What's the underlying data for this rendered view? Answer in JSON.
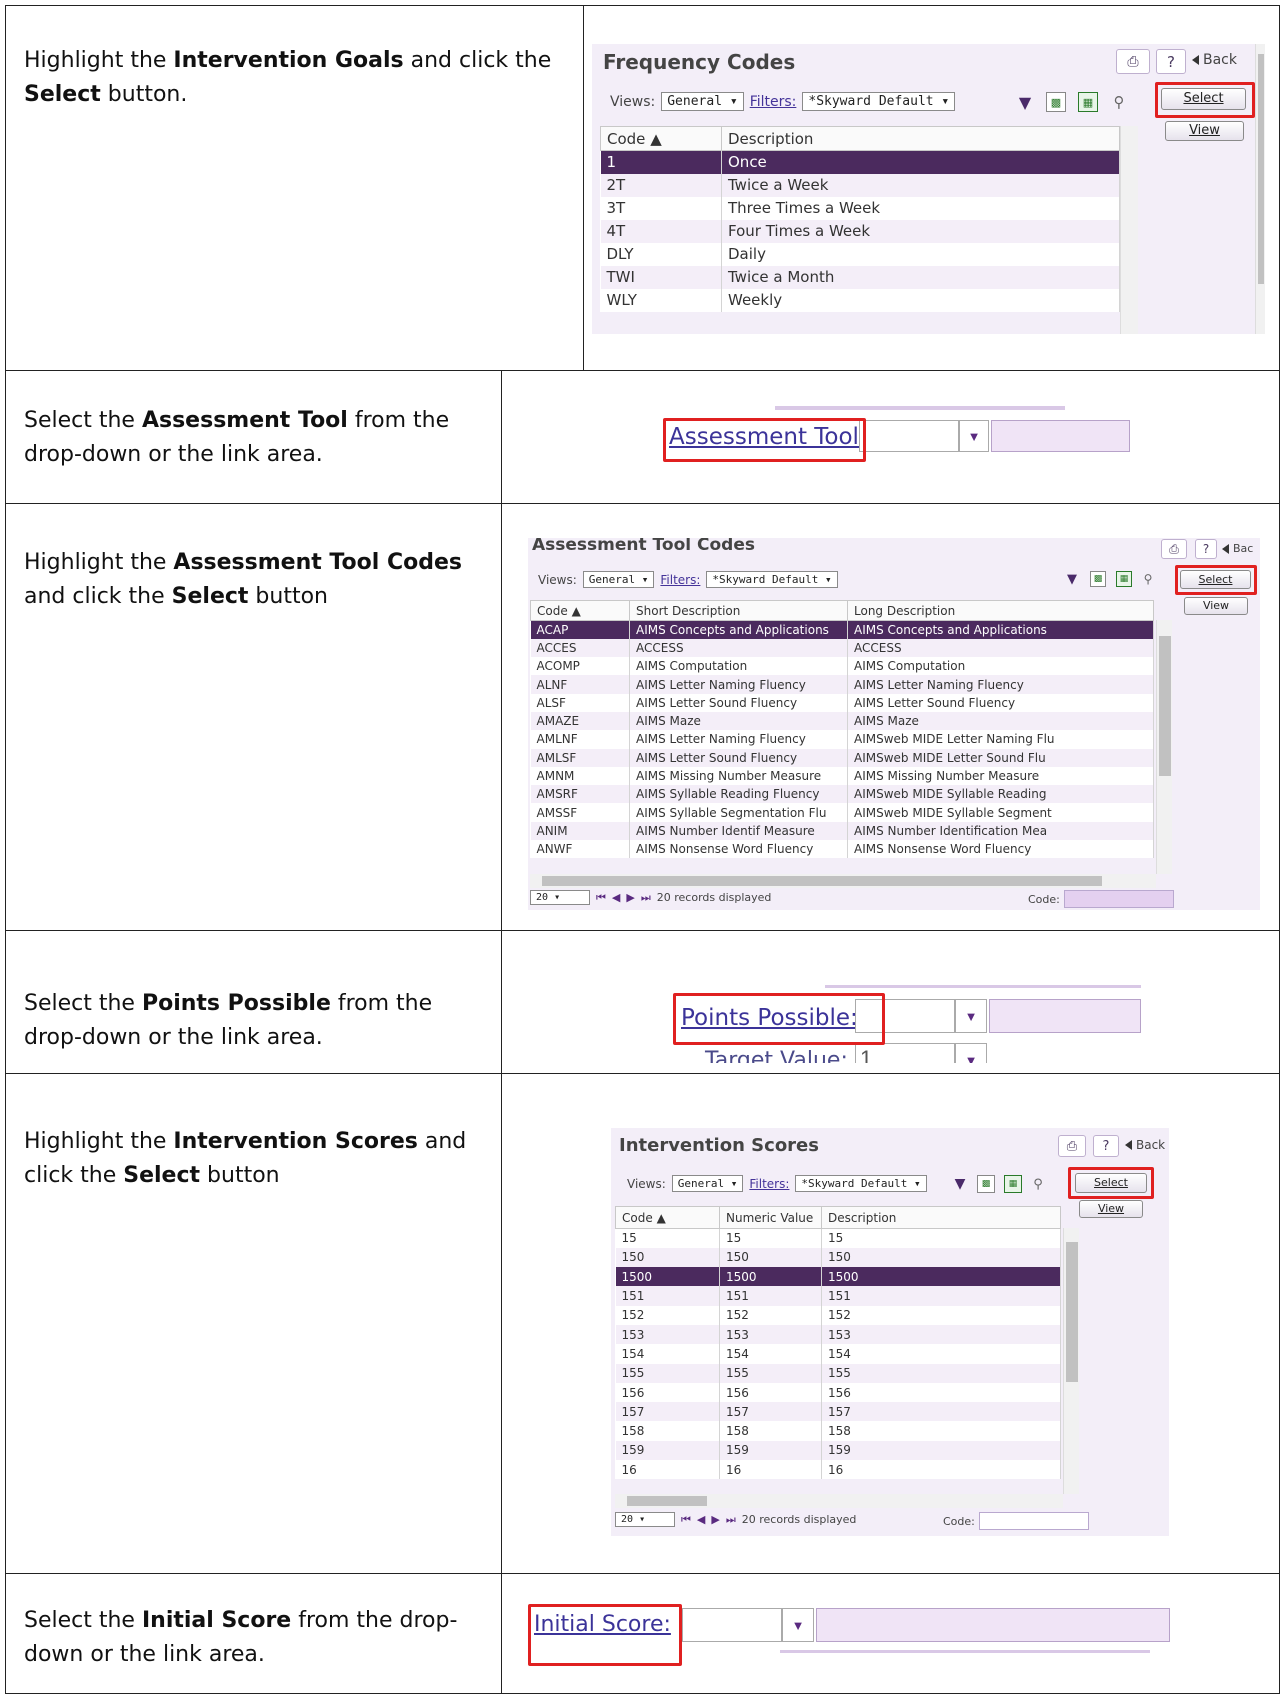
{
  "steps": [
    {
      "pre": "Highlight the ",
      "bold1": "Intervention Goals",
      "mid": " and click the ",
      "bold2": "Select",
      "post": " button."
    },
    {
      "pre": "Select the ",
      "bold1": "Assessment Tool",
      "post": " from the drop-down or the link area."
    },
    {
      "pre": "Highlight the ",
      "bold1": "Assessment Tool Codes",
      "mid": " and click the ",
      "bold2": "Select",
      "post": " button"
    },
    {
      "pre": "Select the ",
      "bold1": "Points Possible",
      "post": " from the drop-down or the link area."
    },
    {
      "pre": "Highlight the ",
      "bold1": "Intervention Scores",
      "mid": " and click the ",
      "bold2": "Select",
      "post": " button"
    },
    {
      "pre": "Select the ",
      "bold1": "Initial Score",
      "post": " from the drop-down or the link area."
    }
  ],
  "common": {
    "views_label": "Views:",
    "views_value": "General",
    "filters_label": "Filters:",
    "filters_value": "*Skyward Default",
    "help": "?",
    "back": "Back",
    "select_btn": "Select",
    "view_btn": "View"
  },
  "freq": {
    "title": "Frequency Codes",
    "columns": [
      "Code",
      "Description"
    ],
    "rows": [
      [
        "1",
        "Once"
      ],
      [
        "2T",
        "Twice a Week"
      ],
      [
        "3T",
        "Three Times a Week"
      ],
      [
        "4T",
        "Four Times a Week"
      ],
      [
        "DLY",
        "Daily"
      ],
      [
        "TWI",
        "Twice a Month"
      ],
      [
        "WLY",
        "Weekly"
      ]
    ]
  },
  "tool_field": {
    "label": "Assessment Tool:"
  },
  "atc": {
    "title": "Assessment Tool Codes",
    "back": "Bac",
    "columns": [
      "Code",
      "Short Description",
      "Long Description"
    ],
    "rows": [
      [
        "ACAP",
        "AIMS Concepts and Applications",
        "AIMS Concepts and Applications"
      ],
      [
        "ACCES",
        "ACCESS",
        "ACCESS"
      ],
      [
        "ACOMP",
        "AIMS Computation",
        "AIMS Computation"
      ],
      [
        "ALNF",
        "AIMS Letter Naming Fluency",
        "AIMS Letter Naming Fluency"
      ],
      [
        "ALSF",
        "AIMS Letter Sound Fluency",
        "AIMS Letter Sound Fluency"
      ],
      [
        "AMAZE",
        "AIMS Maze",
        "AIMS Maze"
      ],
      [
        "AMLNF",
        "AIMS Letter Naming Fluency",
        "AIMSweb MIDE Letter Naming Flu"
      ],
      [
        "AMLSF",
        "AIMS Letter Sound Fluency",
        "AIMSweb MIDE Letter Sound Flu"
      ],
      [
        "AMNM",
        "AIMS Missing Number Measure",
        "AIMS Missing Number Measure"
      ],
      [
        "AMSRF",
        "AIMS Syllable Reading Fluency",
        "AIMSweb MIDE Syllable Reading"
      ],
      [
        "AMSSF",
        "AIMS Syllable Segmentation Flu",
        "AIMSweb MIDE Syllable Segment"
      ],
      [
        "ANIM",
        "AIMS Number Identif Measure",
        "AIMS Number Identification Mea"
      ],
      [
        "ANWF",
        "AIMS Nonsense Word Fluency",
        "AIMS Nonsense Word Fluency"
      ]
    ],
    "page_size": "20",
    "records": "20 records displayed",
    "code_label": "Code:"
  },
  "points_field": {
    "label": "Points Possible:",
    "below_label": "Target Value:",
    "below_value": "1"
  },
  "scores": {
    "title": "Intervention Scores",
    "back": "Back",
    "columns": [
      "Code",
      "Numeric Value",
      "Description"
    ],
    "rows": [
      [
        "15",
        "15",
        "15"
      ],
      [
        "150",
        "150",
        "150"
      ],
      [
        "1500",
        "1500",
        "1500"
      ],
      [
        "151",
        "151",
        "151"
      ],
      [
        "152",
        "152",
        "152"
      ],
      [
        "153",
        "153",
        "153"
      ],
      [
        "154",
        "154",
        "154"
      ],
      [
        "155",
        "155",
        "155"
      ],
      [
        "156",
        "156",
        "156"
      ],
      [
        "157",
        "157",
        "157"
      ],
      [
        "158",
        "158",
        "158"
      ],
      [
        "159",
        "159",
        "159"
      ],
      [
        "16",
        "16",
        "16"
      ]
    ],
    "page_size": "20",
    "records": "20 records displayed",
    "code_label": "Code:"
  },
  "initial_field": {
    "label": "Initial Score:"
  }
}
